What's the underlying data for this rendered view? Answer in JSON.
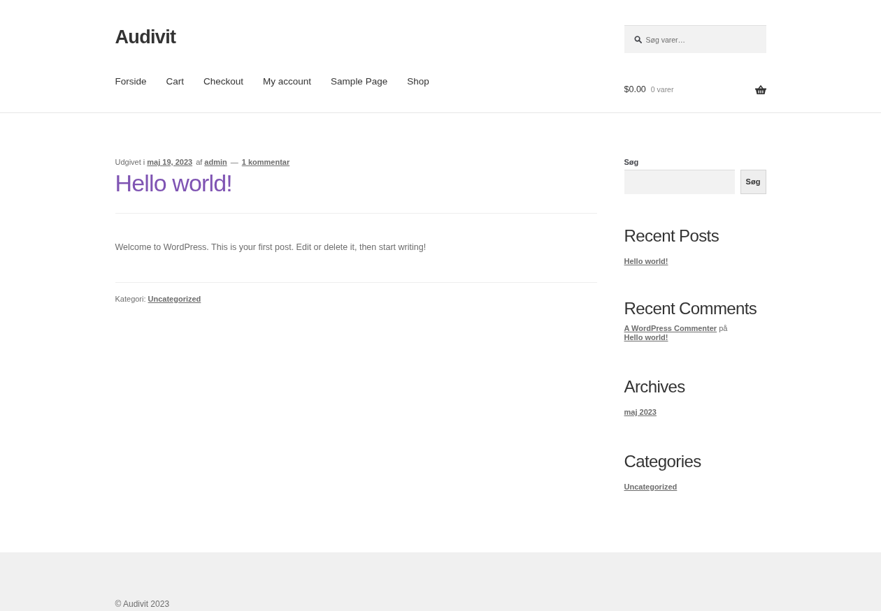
{
  "site_title": "Audivit",
  "product_search": {
    "placeholder": "Søg varer…"
  },
  "nav": [
    {
      "label": "Forside"
    },
    {
      "label": "Cart"
    },
    {
      "label": "Checkout"
    },
    {
      "label": "My account"
    },
    {
      "label": "Sample Page"
    },
    {
      "label": "Shop"
    }
  ],
  "cart": {
    "amount": "$0.00",
    "count": "0 varer"
  },
  "post": {
    "meta": {
      "prefix": "Udgivet i",
      "date": "maj 19, 2023",
      "by": "af",
      "author": "admin",
      "separator": "—",
      "comments": "1 kommentar"
    },
    "title": "Hello world!",
    "body": "Welcome to WordPress. This is your first post. Edit or delete it, then start writing!",
    "category_label": "Kategori:",
    "category": "Uncategorized"
  },
  "sidebar": {
    "search": {
      "label": "Søg",
      "button": "Søg"
    },
    "recent_posts": {
      "heading": "Recent Posts",
      "items": [
        "Hello world!"
      ]
    },
    "recent_comments": {
      "heading": "Recent Comments",
      "items": [
        {
          "author": "A WordPress Commenter",
          "joiner": "på",
          "post": "Hello world!"
        }
      ]
    },
    "archives": {
      "heading": "Archives",
      "items": [
        "maj 2023"
      ]
    },
    "categories": {
      "heading": "Categories",
      "items": [
        "Uncategorized"
      ]
    }
  },
  "footer": {
    "copyright": "© Audivit 2023"
  }
}
